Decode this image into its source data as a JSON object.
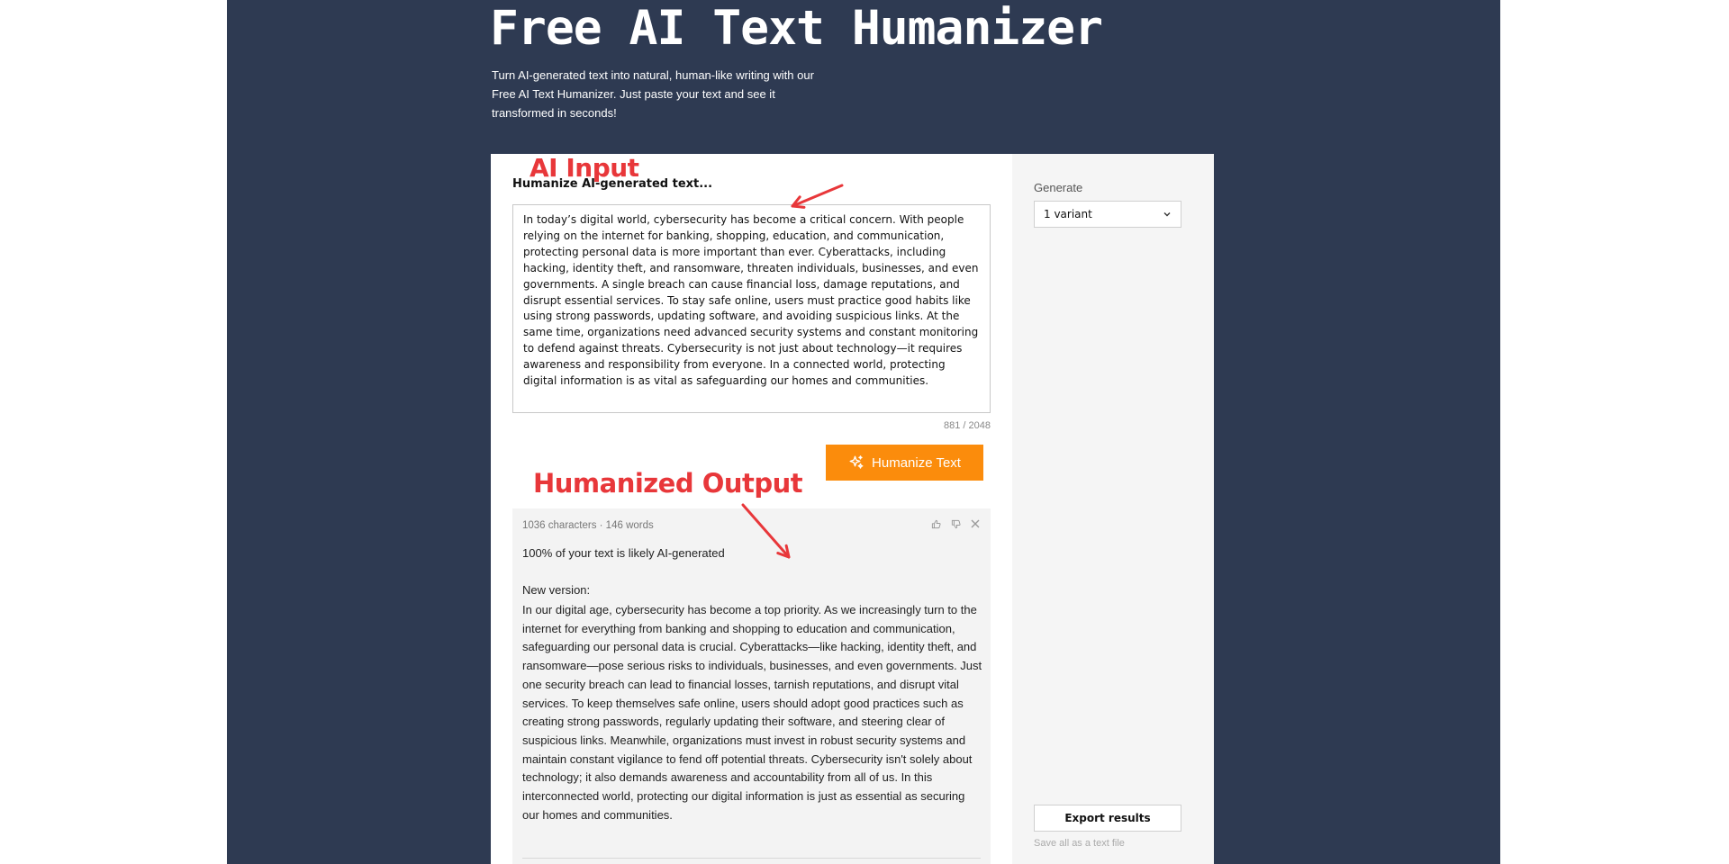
{
  "hero": {
    "title": "Free AI Text Humanizer",
    "description": "Turn AI-generated text into natural, human-like writing with our Free AI Text Humanizer. Just paste your text and see it transformed in seconds!"
  },
  "input": {
    "label": "Humanize AI-generated text...",
    "text": "In today’s digital world, cybersecurity has become a critical concern. With people relying on the internet for banking, shopping, education, and communication, protecting personal data is more important than ever. Cyberattacks, including hacking, identity theft, and ransomware, threaten individuals, businesses, and even governments. A single breach can cause financial loss, damage reputations, and disrupt essential services. To stay safe online, users must practice good habits like using strong passwords, updating software, and avoiding suspicious links. At the same time, organizations need advanced security systems and constant monitoring to defend against threats. Cybersecurity is not just about technology—it requires awareness and responsibility from everyone. In a connected world, protecting digital information is as vital as safeguarding our homes and communities.",
    "counter": "881 / 2048"
  },
  "actions": {
    "humanize_label": "Humanize Text"
  },
  "output": {
    "meta": "1036 characters · 146 words",
    "score": "100% of your text is likely AI-generated",
    "version_label": "New version:",
    "text": "In our digital age, cybersecurity has become a top priority. As we increasingly turn to the internet for everything from banking and shopping to education and communication, safeguarding our personal data is crucial. Cyberattacks—like hacking, identity theft, and ransomware—pose serious risks to individuals, businesses, and even governments. Just one security breach can lead to financial losses, tarnish reputations, and disrupt vital services. To keep themselves safe online, users should adopt good practices such as creating strong passwords, regularly updating their software, and steering clear of suspicious links. Meanwhile, organizations must invest in robust security systems and maintain constant vigilance to fend off potential threats. Cybersecurity isn't solely about technology; it also demands awareness and accountability from all of us. In this interconnected world, protecting our digital information is just as essential as securing our homes and communities."
  },
  "annotations": {
    "ai_input": "AI Input",
    "humanized_output": "Humanized Output"
  },
  "sidebar": {
    "generate_label": "Generate",
    "variant_select": "1 variant",
    "export_label": "Export results",
    "export_hint": "Save all as a text file"
  },
  "colors": {
    "background": "#2e3a52",
    "accent": "#fb8c0c",
    "annotation": "#e8373a"
  },
  "icons": [
    "sparkle-icon",
    "thumbs-up-icon",
    "thumbs-down-icon",
    "close-icon",
    "chevron-down-icon"
  ]
}
